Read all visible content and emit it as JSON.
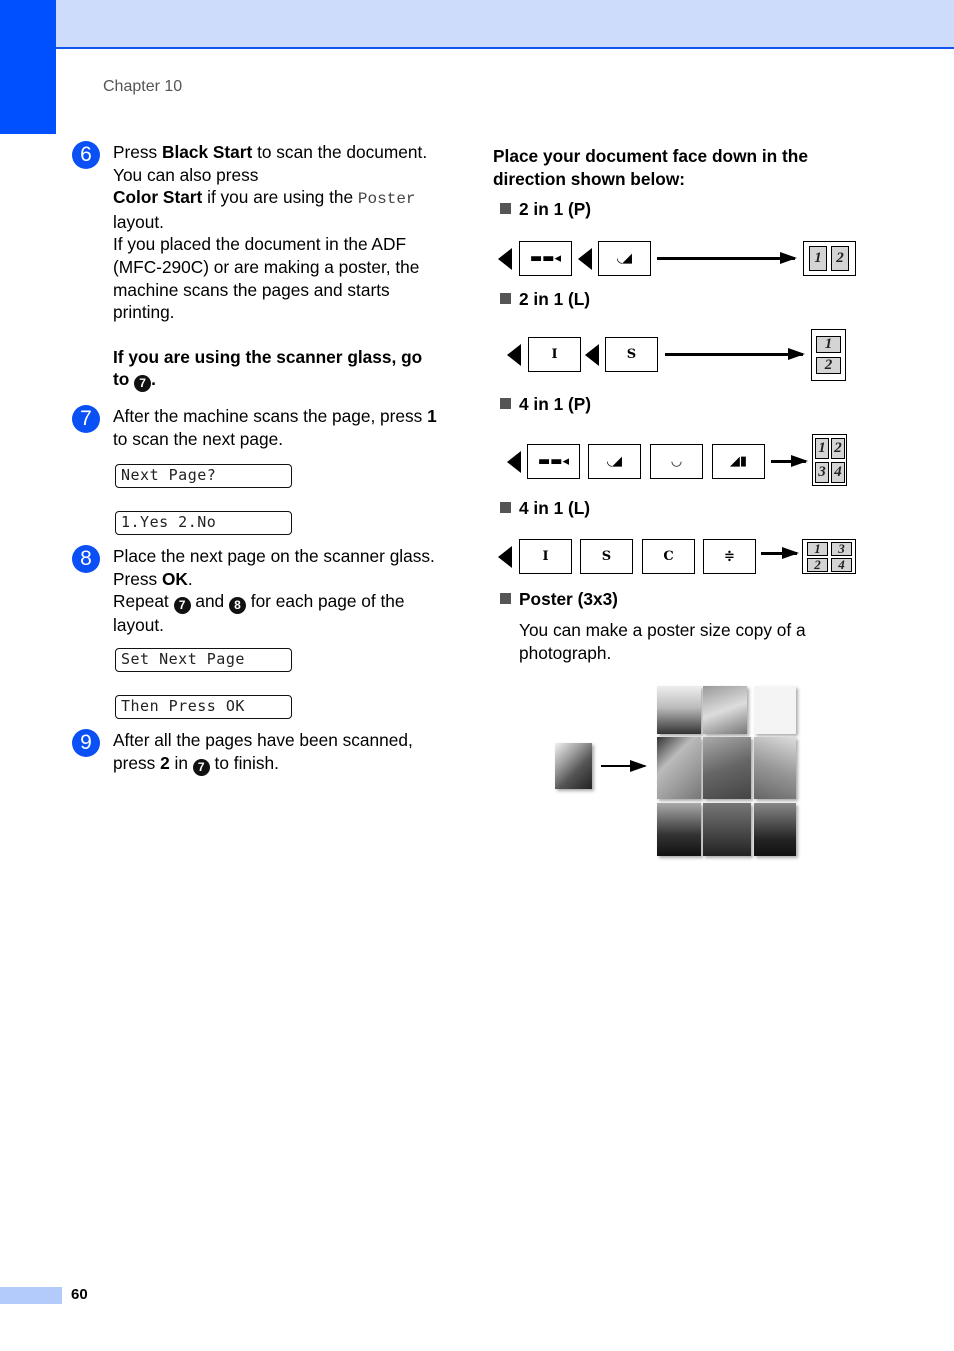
{
  "header": {
    "chapter": "Chapter 10"
  },
  "steps": [
    {
      "num": "6",
      "p1_a": "Press ",
      "p1_b": "Black Start",
      "p1_c": " to scan the document. You can also press ",
      "p1_d": "Color Start",
      "p1_e": " if you are using the ",
      "p1_f": "Poster",
      "p1_g": " layout.",
      "p2": "If you placed the document in the ADF (MFC-290C) or are making a poster, the machine scans the pages and starts printing.",
      "p3": "If you are using the scanner glass, go to ",
      "p3_ref": "7",
      "p3_end": "."
    },
    {
      "num": "7",
      "p1_a": "After the machine scans the page, press ",
      "p1_b": "1",
      "p1_c": " to scan the next page.",
      "lcd": [
        "Next Page?",
        "1.Yes 2.No"
      ]
    },
    {
      "num": "8",
      "p1_a": "Place the next page on the scanner glass. Press ",
      "p1_b": "OK",
      "p1_c": ".",
      "p2_a": "Repeat ",
      "p2_ref1": "7",
      "p2_b": " and ",
      "p2_ref2": "8",
      "p2_c": " for each page of the layout.",
      "lcd": [
        "Set Next Page",
        "Then Press OK"
      ]
    },
    {
      "num": "9",
      "p1_a": "After all the pages have been scanned, press ",
      "p1_b": "2",
      "p1_c": " in ",
      "p1_ref": "7",
      "p1_d": " to finish."
    }
  ],
  "right": {
    "title": "Place your document face down in the direction shown below:",
    "layouts": [
      {
        "label": "2 in 1 (P)",
        "cells": [
          "1",
          "2"
        ]
      },
      {
        "label": "2 in 1 (L)",
        "cells": [
          "1",
          "2"
        ]
      },
      {
        "label": "4 in 1 (P)",
        "cells": [
          "1",
          "2",
          "3",
          "4"
        ]
      },
      {
        "label": "4 in 1 (L)",
        "cells": [
          "1",
          "3",
          "2",
          "4"
        ]
      },
      {
        "label": "Poster (3x3)"
      }
    ],
    "poster_text": "You can make a poster size copy of a photograph."
  },
  "footer": {
    "page": "60"
  }
}
